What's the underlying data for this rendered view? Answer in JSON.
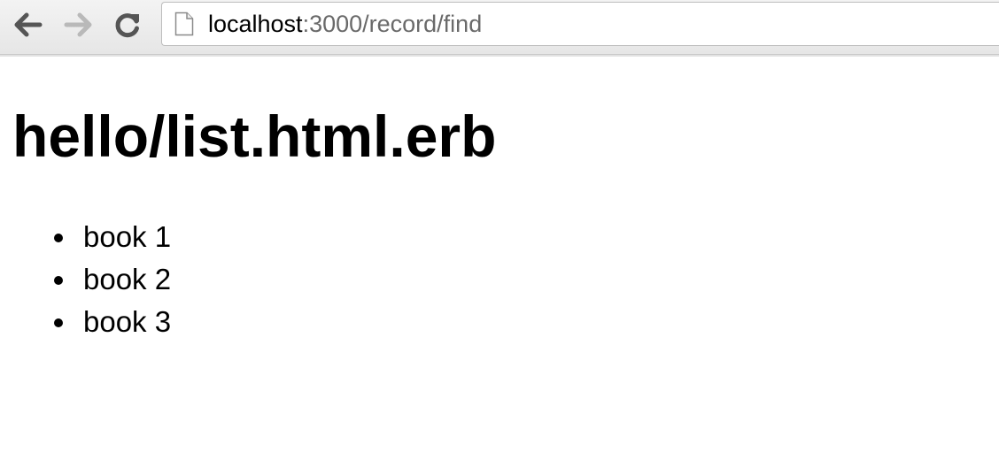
{
  "browser": {
    "url_host": "localhost",
    "url_rest": ":3000/record/find",
    "icons": {
      "back": "arrow-left-icon",
      "forward": "arrow-right-icon",
      "reload": "reload-icon",
      "page": "page-icon"
    }
  },
  "page": {
    "heading": "hello/list.html.erb",
    "items": [
      "book 1",
      "book 2",
      "book 3"
    ]
  }
}
